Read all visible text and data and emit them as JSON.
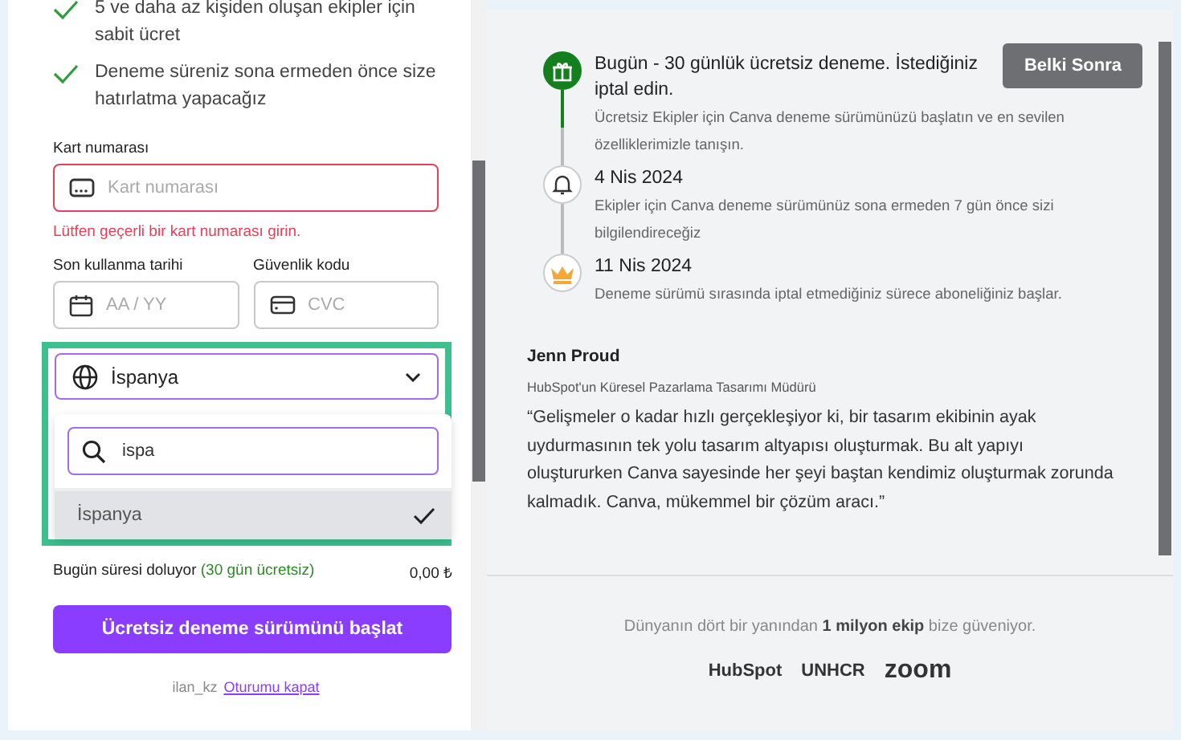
{
  "benefits": [
    {
      "text": "5 ve daha az kişiden oluşan ekipler için sabit ücret"
    },
    {
      "text": "Deneme süreniz sona ermeden önce size hatırlatma yapacağız"
    }
  ],
  "card_number": {
    "label": "Kart numarası",
    "placeholder": "Kart numarası",
    "error": "Lütfen geçerli bir kart numarası girin."
  },
  "expiry": {
    "label": "Son kullanma tarihi",
    "placeholder": "AA / YY"
  },
  "security_code": {
    "label": "Güvenlik kodu",
    "placeholder": "CVC"
  },
  "country": {
    "value": "İspanya",
    "search": "ispa",
    "options": [
      {
        "label": "İspanya",
        "selected": true
      }
    ]
  },
  "summary": {
    "label": "Bugün süresi doluyor",
    "note": "(30 gün ücretsiz)",
    "amount": "0,00 ₺"
  },
  "start_button": "Ücretsiz deneme sürümünü başlat",
  "footer": {
    "user": "ilan_kz",
    "logout": "Oturumu kapat"
  },
  "later_button": "Belki Sonra",
  "timeline": [
    {
      "kind": "gift",
      "title_lines": [
        "Bugün - 30 günlük ücretsiz deneme. İstediğiniz",
        "iptal edin."
      ],
      "text": "Ücretsiz Ekipler için Canva deneme sürümünüzü başlatın ve en sevilen özelliklerimizle tanışın."
    },
    {
      "kind": "bell",
      "title_lines": [
        "4 Nis 2024"
      ],
      "text": "Ekipler için Canva deneme sürümünüz sona ermeden 7 gün önce sizi bilgilendireceğiz"
    },
    {
      "kind": "crown",
      "title_lines": [
        "11 Nis 2024"
      ],
      "text": "Deneme sürümü sırasında iptal etmediğiniz sürece aboneliğiniz başlar."
    }
  ],
  "testimonial": {
    "name": "Jenn Proud",
    "role": "HubSpot'un Küresel Pazarlama Tasarımı Müdürü",
    "quote": "“Gelişmeler o kadar hızlı gerçekleşiyor ki, bir tasarım ekibinin ayak uydurmasının tek yolu tasarım altyapısı oluşturmak. Bu alt yapıyı oluştururken Canva sayesinde her şeyi baştan kendimiz oluşturmak zorunda kalmadık. Canva, mükemmel bir çözüm aracı.”"
  },
  "trust": "Dünyanın dört bir yanından **1 milyon ekip** bize güveniyor.",
  "logos": [
    "HubSpot",
    "UNHCR",
    "zoom"
  ]
}
